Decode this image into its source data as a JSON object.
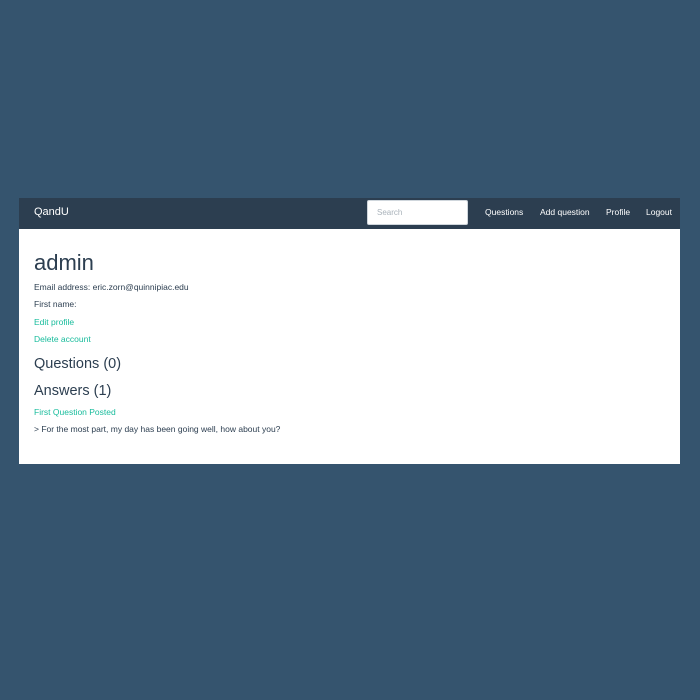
{
  "navbar": {
    "brand": "QandU",
    "search_placeholder": "Search",
    "search_value": "",
    "links": [
      "Questions",
      "Add question",
      "Profile",
      "Logout"
    ]
  },
  "profile": {
    "username": "admin",
    "email_label": "Email address:",
    "email": "eric.zorn@quinnipiac.edu",
    "first_name_label": "First name:",
    "first_name": "",
    "edit_label": "Edit profile",
    "delete_label": "Delete account"
  },
  "questions": {
    "heading": "Questions (0)"
  },
  "answers": {
    "heading": "Answers (1)",
    "items": [
      {
        "question_title": "First Question Posted",
        "answer_text": "> For the most part, my day has been going well, how about you?"
      }
    ]
  },
  "colors": {
    "background": "#35546e",
    "navbar": "#2c3e50",
    "link": "#18bc9c",
    "text": "#2c3e50"
  }
}
